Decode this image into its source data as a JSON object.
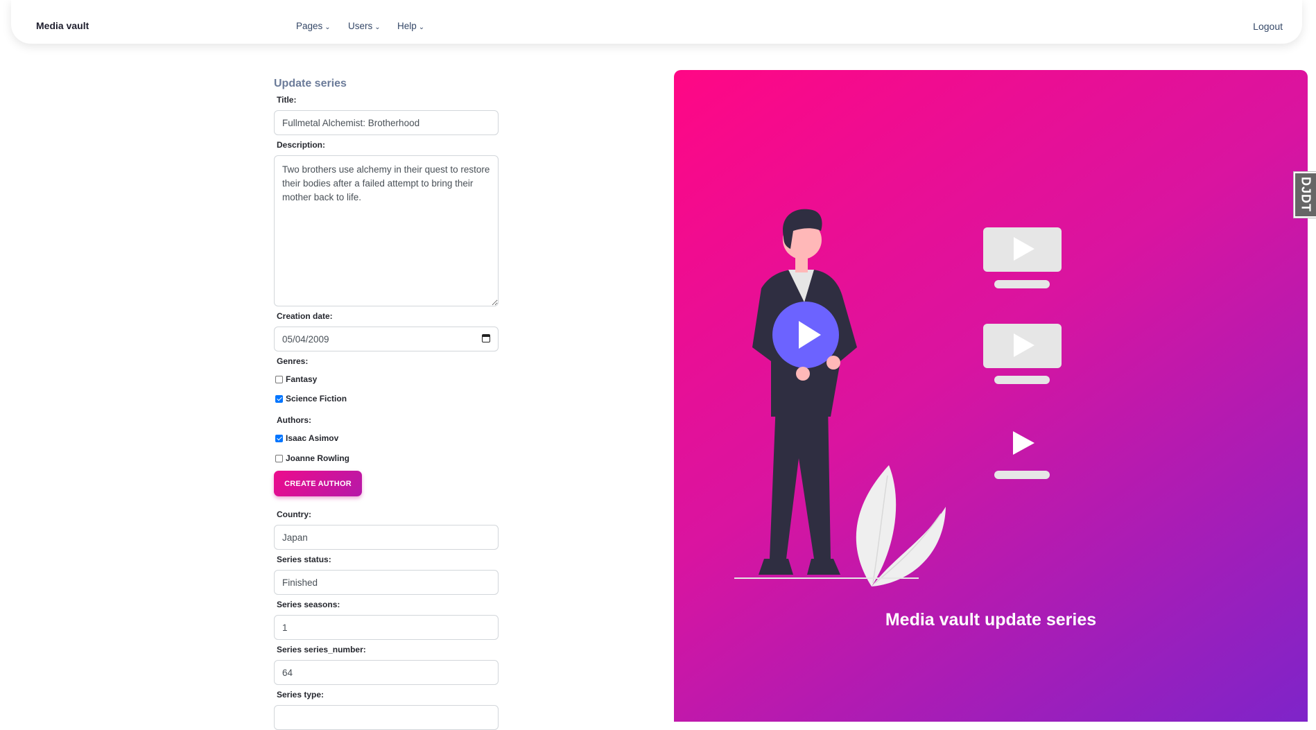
{
  "navbar": {
    "brand": "Media vault",
    "items": [
      {
        "label": "Pages"
      },
      {
        "label": "Users"
      },
      {
        "label": "Help"
      }
    ],
    "logout": "Logout"
  },
  "form": {
    "title": "Update series",
    "title_label": "Title:",
    "title_value": "Fullmetal Alchemist: Brotherhood",
    "description_label": "Description:",
    "description_value": "Two brothers use alchemy in their quest to restore their bodies after a failed attempt to bring their mother back to life.",
    "creation_date_label": "Creation date:",
    "creation_date_value": "05/04/2009",
    "genres_label": "Genres:",
    "genres": [
      {
        "label": "Fantasy",
        "checked": false
      },
      {
        "label": "Science Fiction",
        "checked": true
      }
    ],
    "authors_label": "Authors:",
    "authors": [
      {
        "label": "Isaac Asimov",
        "checked": true
      },
      {
        "label": "Joanne Rowling",
        "checked": false
      }
    ],
    "create_author_button": "CREATE AUTHOR",
    "country_label": "Country:",
    "country_value": "Japan",
    "status_label": "Series status:",
    "status_value": "Finished",
    "seasons_label": "Series seasons:",
    "seasons_value": "1",
    "series_number_label": "Series series_number:",
    "series_number_value": "64",
    "type_label": "Series type:"
  },
  "hero": {
    "title": "Media vault update series",
    "illustration": "person-with-play-buttons-illustration"
  },
  "debug_toolbar": {
    "label": "DJDT"
  },
  "colors": {
    "gradient_start": "#ff0785",
    "gradient_end": "#7e24c9",
    "button_gradient": "#ec0c8c",
    "checkbox_checked": "#0075ff"
  }
}
